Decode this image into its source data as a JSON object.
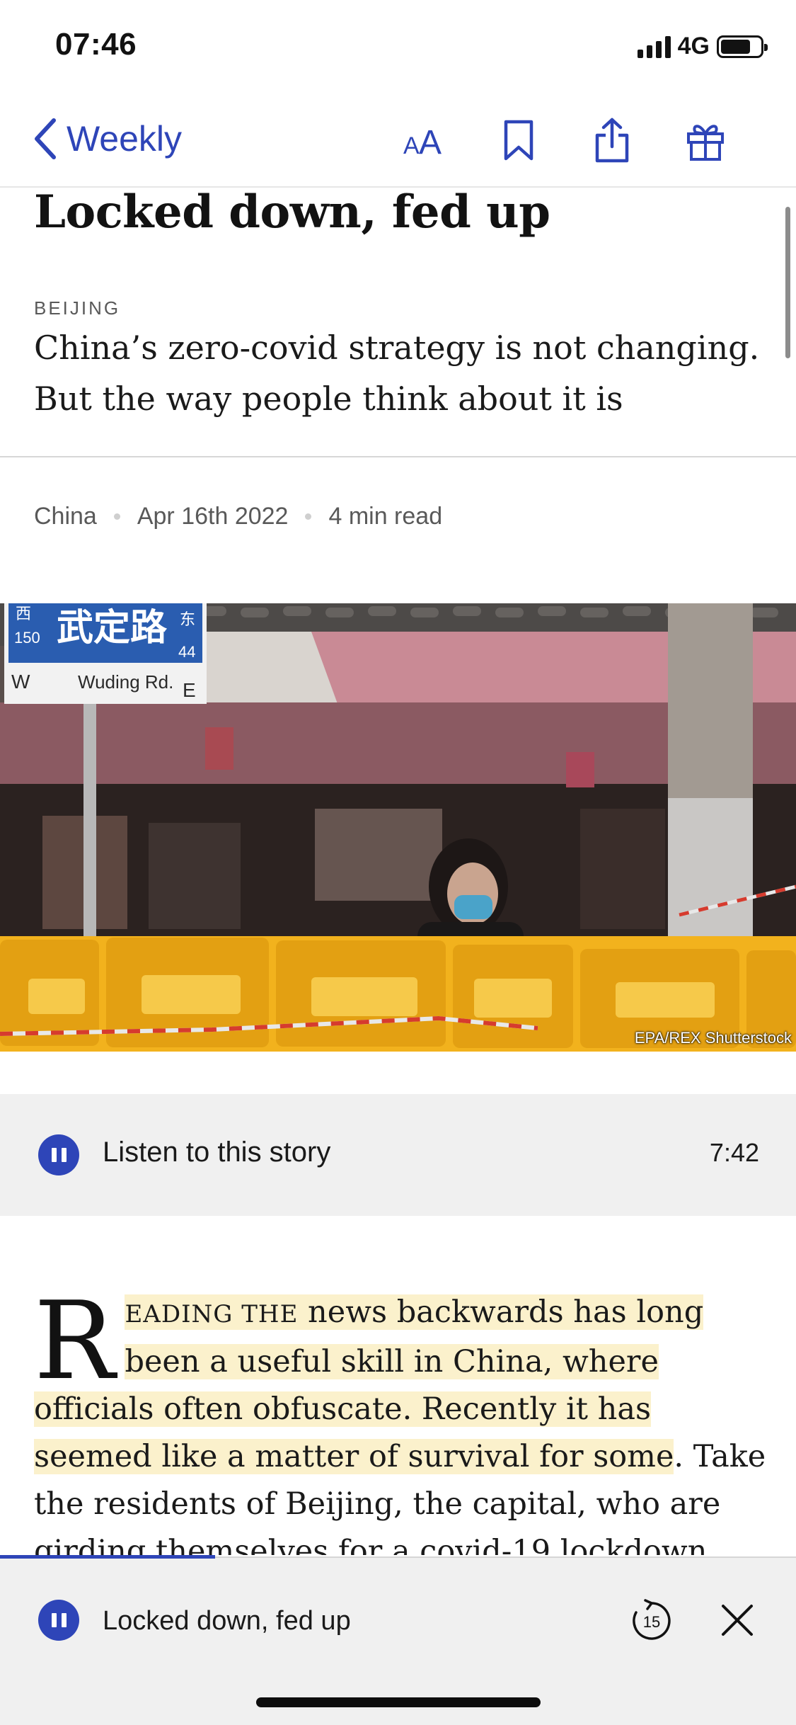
{
  "status_bar": {
    "time": "07:46",
    "network": "4G",
    "battery_level": 0.76
  },
  "nav": {
    "back_label": "Weekly",
    "font_size_icon": "text-size-icon",
    "icons": [
      "chevron-left-icon",
      "text-size-icon",
      "bookmark-icon",
      "share-icon",
      "gift-icon"
    ]
  },
  "article": {
    "headline": "Locked down, fed up",
    "dateline": "BEIJING",
    "rubric": "China’s zero-covid strategy is not changing. But the way people think about it is",
    "section": "China",
    "date": "Apr 16th 2022",
    "read_time": "4 min read",
    "photo_credit": "EPA/REX Shutterstock",
    "photo_sign": {
      "chinese": "武定路",
      "english": "Wuding Rd.",
      "left_num": "150",
      "right_num": "44",
      "west": "W",
      "east": "E",
      "west_char": "西",
      "east_char": "东"
    },
    "body": {
      "drop_cap": "R",
      "small_caps": "EADING THE",
      "highlight_1": " news backwards has long been a useful skill in China, where officials often obfuscate. Recently it has seemed like a matter of survival for some",
      "rest": ". Take the residents of Beijing, the capital, who are girding themselves for a covid-19 lockdown and all the hardship that might"
    }
  },
  "audio": {
    "label": "Listen to this story",
    "duration": "7:42",
    "state": "playing"
  },
  "mini_player": {
    "title": "Locked down, fed up",
    "skip_seconds": "15",
    "progress": 0.27
  },
  "colors": {
    "accent": "#2e45b8",
    "highlight": "#fbf1cc",
    "bar_background": "#f0f0f0"
  }
}
